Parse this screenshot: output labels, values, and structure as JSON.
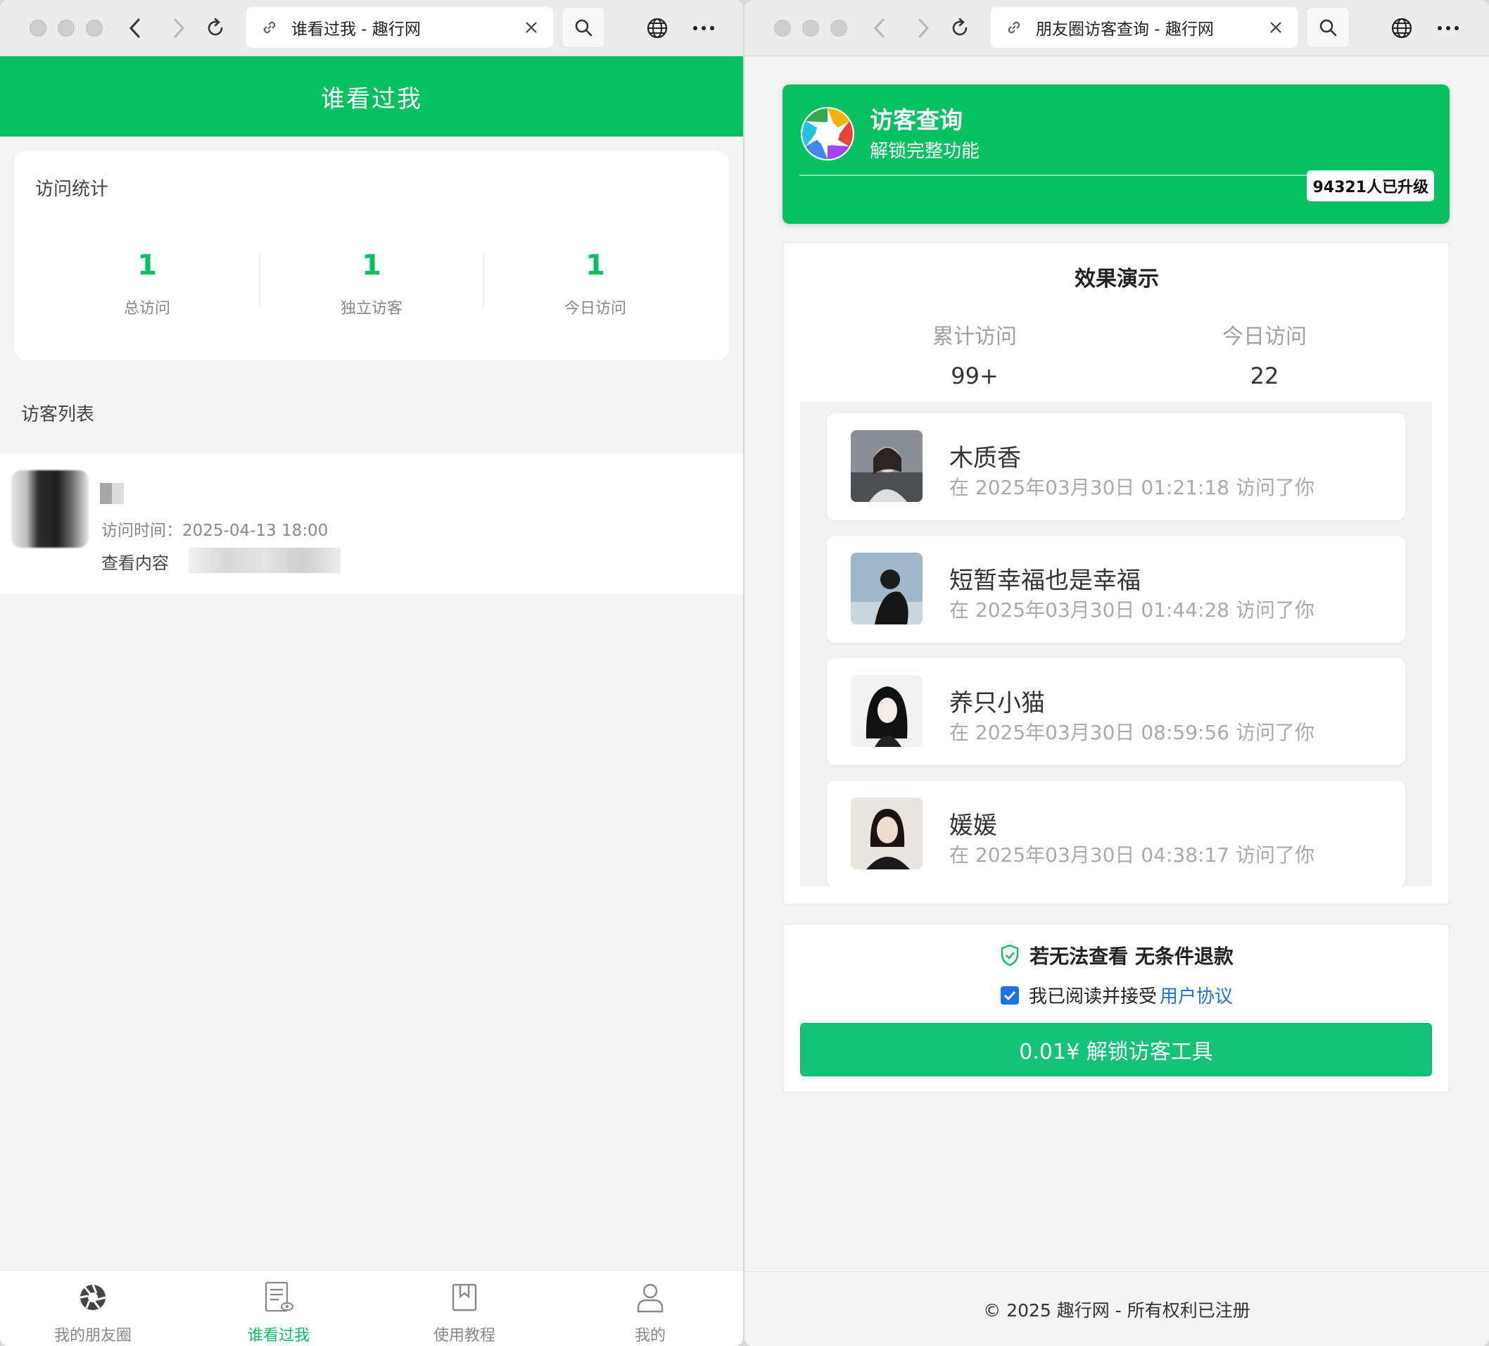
{
  "left_window": {
    "tab_title": "谁看过我 - 趣行网",
    "header_title": "谁看过我",
    "stats": {
      "title": "访问统计",
      "items": [
        {
          "value": "1",
          "label": "总访问"
        },
        {
          "value": "1",
          "label": "独立访客"
        },
        {
          "value": "1",
          "label": "今日访问"
        }
      ]
    },
    "visitor_list": {
      "title": "访客列表",
      "rows": [
        {
          "time": "访问时间：2025-04-13 18:00",
          "content_label": "查看内容"
        }
      ]
    },
    "tabbar": [
      {
        "label": "我的朋友圈",
        "icon": "shutter-icon",
        "active": false
      },
      {
        "label": "谁看过我",
        "icon": "document-eye-icon",
        "active": true
      },
      {
        "label": "使用教程",
        "icon": "bookmark-icon",
        "active": false
      },
      {
        "label": "我的",
        "icon": "user-icon",
        "active": false
      }
    ]
  },
  "right_window": {
    "tab_title": "朋友圈访客查询 - 趣行网",
    "promo": {
      "title": "访客查询",
      "subtitle": "解锁完整功能",
      "badge": "94321人已升级"
    },
    "demo": {
      "title": "效果演示",
      "stats": [
        {
          "label": "累计访问",
          "value": "99+"
        },
        {
          "label": "今日访问",
          "value": "22"
        }
      ],
      "visitors": [
        {
          "name": "木质香",
          "time": "在 2025年03月30日 01:21:18 访问了你"
        },
        {
          "name": "短暂幸福也是幸福",
          "time": "在 2025年03月30日 01:44:28 访问了你"
        },
        {
          "name": "养只小猫",
          "time": "在 2025年03月30日 08:59:56 访问了你"
        },
        {
          "name": "媛媛",
          "time": "在 2025年03月30日 04:38:17 访问了你"
        }
      ]
    },
    "refund": {
      "text": "若无法查看 无条件退款",
      "agree_text": "我已阅读并接受",
      "agree_link": "用户协议",
      "checked": true,
      "pay_button": "0.01¥ 解锁访客工具"
    },
    "footer": "© 2025 趣行网 - 所有权利已注册"
  },
  "colors": {
    "brand_green": "#07c160",
    "button_green": "#14c278",
    "link_blue": "#1a73e8"
  }
}
